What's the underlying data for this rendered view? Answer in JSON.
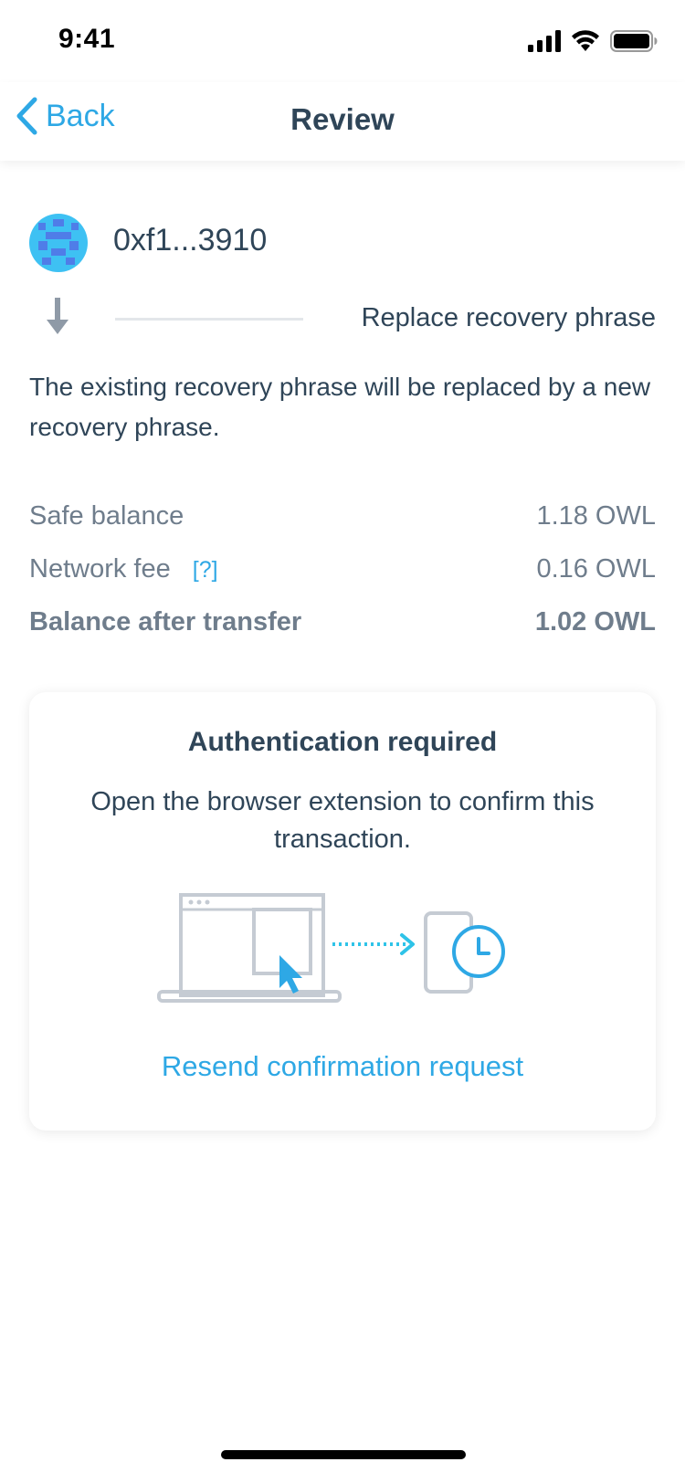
{
  "status_bar": {
    "time": "9:41",
    "icons": [
      "cellular-signal-icon",
      "wifi-icon",
      "battery-icon"
    ]
  },
  "nav": {
    "back_label": "Back",
    "title": "Review"
  },
  "transaction": {
    "address": "0xf1...3910",
    "action": "Replace recovery phrase",
    "description": "The existing recovery phrase will be replaced by a new recovery phrase."
  },
  "summary": {
    "safe_balance_label": "Safe balance",
    "safe_balance_value": "1.18 OWL",
    "network_fee_label": "Network fee",
    "network_fee_help": "[?]",
    "network_fee_value": "0.16 OWL",
    "balance_after_label": "Balance after transfer",
    "balance_after_value": "1.02 OWL"
  },
  "auth_card": {
    "title": "Authentication required",
    "text": "Open the browser extension to confirm this transaction.",
    "resend_label": "Resend confirmation request"
  },
  "colors": {
    "accent": "#2ea8e5",
    "text_dark": "#2f4558",
    "text_muted": "#6f7d8c",
    "illustration_gray": "#c5cbd3"
  }
}
